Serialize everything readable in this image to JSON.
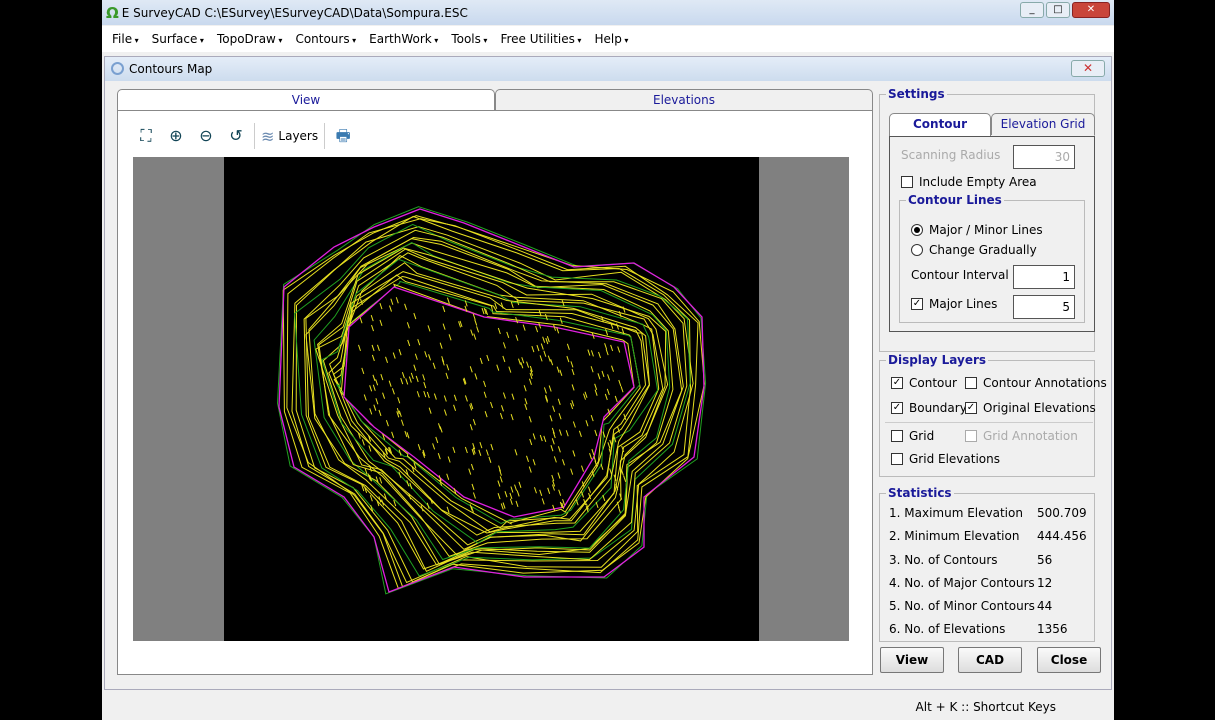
{
  "app": {
    "title": "E SurveyCAD C:\\ESurvey\\ESurveyCAD\\Data\\Sompura.ESC"
  },
  "menu": [
    "File",
    "Surface",
    "TopoDraw",
    "Contours",
    "EarthWork",
    "Tools",
    "Free Utilities",
    "Help"
  ],
  "window": {
    "title": "Contours Map"
  },
  "tabs": {
    "view": "View",
    "elevations": "Elevations"
  },
  "toolbar": {
    "layers": "Layers"
  },
  "settings": {
    "legend": "Settings",
    "tab_contour": "Contour",
    "tab_grid": "Elevation Grid",
    "scanning_radius_label": "Scanning Radius",
    "scanning_radius": "30",
    "include_empty": "Include Empty Area",
    "contour_lines_legend": "Contour Lines",
    "major_minor": "Major / Minor Lines",
    "change_gradually": "Change Gradually",
    "contour_interval_label": "Contour Interval",
    "contour_interval": "1",
    "major_lines_label": "Major Lines",
    "major_lines": "5"
  },
  "display_layers": {
    "legend": "Display Layers",
    "contour": "Contour",
    "contour_annotations": "Contour Annotations",
    "boundary": "Boundary",
    "original_elevations": "Original Elevations",
    "grid": "Grid",
    "grid_annotation": "Grid Annotation",
    "grid_elevations": "Grid Elevations"
  },
  "statistics": {
    "legend": "Statistics",
    "items": [
      {
        "label": "1. Maximum Elevation",
        "value": "500.709"
      },
      {
        "label": "2. Minimum Elevation",
        "value": "444.456"
      },
      {
        "label": "3. No. of Contours",
        "value": "56"
      },
      {
        "label": "4. No. of Major Contours",
        "value": "12"
      },
      {
        "label": "5. No. of Minor Contours",
        "value": "44"
      },
      {
        "label": "6. No. of Elevations",
        "value": "1356"
      }
    ]
  },
  "buttons": {
    "view": "View",
    "cad": "CAD",
    "close": "Close"
  },
  "status": {
    "shortcut": "Alt + K :: Shortcut Keys"
  },
  "colors": {
    "contour": "#e8e020",
    "major": "#20a020",
    "boundary": "#e020e0"
  }
}
